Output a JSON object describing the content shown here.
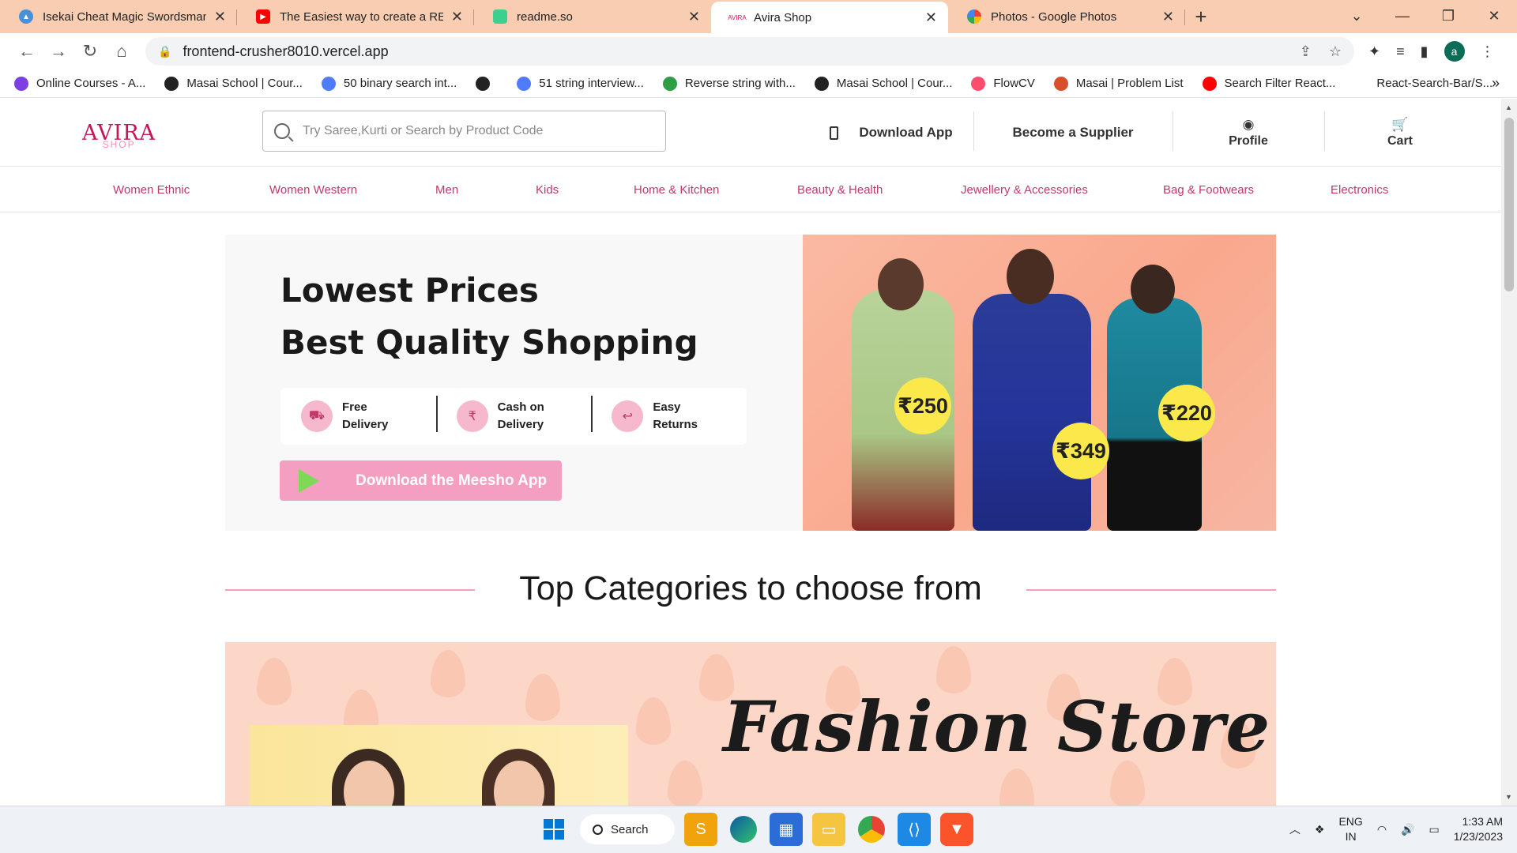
{
  "browser": {
    "tabs": [
      {
        "title": "Isekai Cheat Magic Swordsman M",
        "favicon_color": "#4a90d9",
        "active": false
      },
      {
        "title": "The Easiest way to create a READ",
        "favicon_color": "#ff0000",
        "active": false
      },
      {
        "title": "readme.so",
        "favicon_color": "#3ccf8e",
        "active": false
      },
      {
        "title": "Avira Shop",
        "favicon_color": "#c2185b",
        "active": true
      },
      {
        "title": "Photos - Google Photos",
        "favicon_color": "#fbbc05",
        "active": false
      }
    ],
    "url": "frontend-crusher8010.vercel.app",
    "profile_initial": "a",
    "bookmarks": [
      {
        "label": "Online Courses - A...",
        "color": "#7b3fe4"
      },
      {
        "label": "Masai School | Cour...",
        "color": "#222222"
      },
      {
        "label": "50 binary search int...",
        "color": "#4f7cff"
      },
      {
        "label": "",
        "color": "#222222"
      },
      {
        "label": "51 string interview...",
        "color": "#4f7cff"
      },
      {
        "label": "Reverse string with...",
        "color": "#2e9e44"
      },
      {
        "label": "Masai School | Cour...",
        "color": "#222222"
      },
      {
        "label": "FlowCV",
        "color": "#ff4d6d"
      },
      {
        "label": "Masai | Problem List",
        "color": "#d94f2a"
      },
      {
        "label": "Search Filter React...",
        "color": "#ff0000"
      },
      {
        "label": "React-Search-Bar/S...",
        "color": "#ffffff"
      }
    ]
  },
  "site": {
    "logo_text": "AVIRA",
    "logo_sub": "SHOP",
    "search_placeholder": "Try Saree,Kurti or Search by Product Code",
    "header_links": {
      "download_app": "Download App",
      "become_supplier": "Become a Supplier",
      "profile": "Profile",
      "cart": "Cart"
    },
    "categories": [
      "Women Ethnic",
      "Women Western",
      "Men",
      "Kids",
      "Home & Kitchen",
      "Beauty & Health",
      "Jewellery & Accessories",
      "Bag & Footwears",
      "Electronics"
    ],
    "hero": {
      "line1": "Lowest Prices",
      "line2": "Best Quality Shopping",
      "features": [
        {
          "line1": "Free",
          "line2": "Delivery",
          "icon": "truck-icon"
        },
        {
          "line1": "Cash on",
          "line2": "Delivery",
          "icon": "cash-icon"
        },
        {
          "line1": "Easy",
          "line2": "Returns",
          "icon": "return-icon"
        }
      ],
      "cta": "Download the Meesho App",
      "prices": [
        "₹250",
        "₹349",
        "₹220"
      ]
    },
    "top_categories_title": "Top Categories to choose from",
    "banner_title": "Fashion Store"
  },
  "taskbar": {
    "search_label": "Search",
    "lang_line1": "ENG",
    "lang_line2": "IN",
    "time": "1:33 AM",
    "date": "1/23/2023"
  },
  "colors": {
    "accent_pink": "#c0396b",
    "tab_bar": "#f9cdb1",
    "cta_pink": "#f49fc1",
    "price_badge": "#fbe84a"
  }
}
